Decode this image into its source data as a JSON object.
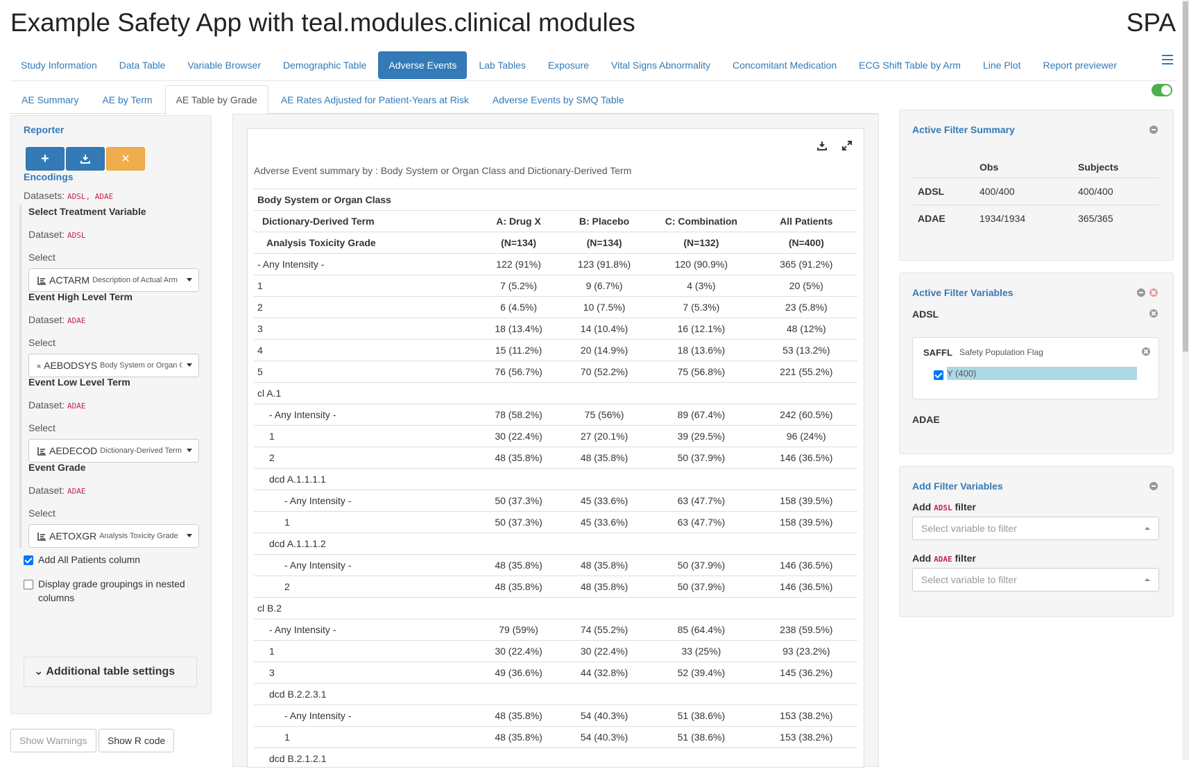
{
  "app": {
    "title": "Example Safety App with teal.modules.clinical modules",
    "brand": "SPA"
  },
  "main_nav": [
    {
      "label": "Study Information",
      "active": false
    },
    {
      "label": "Data Table",
      "active": false
    },
    {
      "label": "Variable Browser",
      "active": false
    },
    {
      "label": "Demographic Table",
      "active": false
    },
    {
      "label": "Adverse Events",
      "active": true
    },
    {
      "label": "Lab Tables",
      "active": false
    },
    {
      "label": "Exposure",
      "active": false
    },
    {
      "label": "Vital Signs Abnormality",
      "active": false
    },
    {
      "label": "Concomitant Medication",
      "active": false
    },
    {
      "label": "ECG Shift Table by Arm",
      "active": false
    },
    {
      "label": "Line Plot",
      "active": false
    },
    {
      "label": "Report previewer",
      "active": false
    }
  ],
  "sub_tabs": [
    {
      "label": "AE Summary",
      "active": false
    },
    {
      "label": "AE by Term",
      "active": false
    },
    {
      "label": "AE Table by Grade",
      "active": true
    },
    {
      "label": "AE Rates Adjusted for Patient-Years at Risk",
      "active": false
    },
    {
      "label": "Adverse Events by SMQ Table",
      "active": false
    }
  ],
  "left_panel": {
    "reporter_label": "Reporter",
    "encodings_label": "Encodings",
    "datasets_label": "Datasets:",
    "datasets_value": "ADSL, ADAE",
    "dataset_prefix": "Dataset:",
    "select_label": "Select",
    "encodings": [
      {
        "title": "Select Treatment Variable",
        "dataset": "ADSL",
        "var": "ACTARM",
        "desc": "Description of Actual Arm"
      },
      {
        "title": "Event High Level Term",
        "dataset": "ADAE",
        "var": "AEBODSYS",
        "desc": "Body System or Organ Class"
      },
      {
        "title": "Event Low Level Term",
        "dataset": "ADAE",
        "var": "AEDECOD",
        "desc": "Dictionary-Derived Term"
      },
      {
        "title": "Event Grade",
        "dataset": "ADAE",
        "var": "AETOXGR",
        "desc": "Analysis Toxicity Grade"
      }
    ],
    "checkbox_all_patients": "Add All Patients column",
    "checkbox_grade_groupings_1": "Display grade groupings in nested",
    "checkbox_grade_groupings_2": "columns",
    "additional_settings": "Additional table settings",
    "show_warnings": "Show Warnings",
    "show_r_code": "Show R code"
  },
  "table": {
    "title": "Adverse Event summary by : Body System or Organ Class and Dictionary-Derived Term",
    "header_row1": "Body System or Organ Class",
    "header_row2": [
      "Dictionary-Derived Term",
      "A: Drug X",
      "B: Placebo",
      "C: Combination",
      "All Patients"
    ],
    "header_row3": [
      "Analysis Toxicity Grade",
      "(N=134)",
      "(N=134)",
      "(N=132)",
      "(N=400)"
    ],
    "rows": [
      {
        "label": "- Any Intensity -",
        "indent": 0,
        "vals": [
          "122 (91%)",
          "123 (91.8%)",
          "120 (90.9%)",
          "365 (91.2%)"
        ]
      },
      {
        "label": "1",
        "indent": 0,
        "vals": [
          "7 (5.2%)",
          "9 (6.7%)",
          "4 (3%)",
          "20 (5%)"
        ]
      },
      {
        "label": "2",
        "indent": 0,
        "vals": [
          "6 (4.5%)",
          "10 (7.5%)",
          "7 (5.3%)",
          "23 (5.8%)"
        ]
      },
      {
        "label": "3",
        "indent": 0,
        "vals": [
          "18 (13.4%)",
          "14 (10.4%)",
          "16 (12.1%)",
          "48 (12%)"
        ]
      },
      {
        "label": "4",
        "indent": 0,
        "vals": [
          "15 (11.2%)",
          "20 (14.9%)",
          "18 (13.6%)",
          "53 (13.2%)"
        ]
      },
      {
        "label": "5",
        "indent": 0,
        "vals": [
          "76 (56.7%)",
          "70 (52.2%)",
          "75 (56.8%)",
          "221 (55.2%)"
        ]
      },
      {
        "label": "cl A.1",
        "indent": 0,
        "vals": [
          "",
          "",
          "",
          ""
        ]
      },
      {
        "label": "- Any Intensity -",
        "indent": 1,
        "vals": [
          "78 (58.2%)",
          "75 (56%)",
          "89 (67.4%)",
          "242 (60.5%)"
        ]
      },
      {
        "label": "1",
        "indent": 1,
        "vals": [
          "30 (22.4%)",
          "27 (20.1%)",
          "39 (29.5%)",
          "96 (24%)"
        ]
      },
      {
        "label": "2",
        "indent": 1,
        "vals": [
          "48 (35.8%)",
          "48 (35.8%)",
          "50 (37.9%)",
          "146 (36.5%)"
        ]
      },
      {
        "label": "dcd A.1.1.1.1",
        "indent": 1,
        "vals": [
          "",
          "",
          "",
          ""
        ]
      },
      {
        "label": "- Any Intensity -",
        "indent": 2,
        "vals": [
          "50 (37.3%)",
          "45 (33.6%)",
          "63 (47.7%)",
          "158 (39.5%)"
        ]
      },
      {
        "label": "1",
        "indent": 2,
        "vals": [
          "50 (37.3%)",
          "45 (33.6%)",
          "63 (47.7%)",
          "158 (39.5%)"
        ]
      },
      {
        "label": "dcd A.1.1.1.2",
        "indent": 1,
        "vals": [
          "",
          "",
          "",
          ""
        ]
      },
      {
        "label": "- Any Intensity -",
        "indent": 2,
        "vals": [
          "48 (35.8%)",
          "48 (35.8%)",
          "50 (37.9%)",
          "146 (36.5%)"
        ]
      },
      {
        "label": "2",
        "indent": 2,
        "vals": [
          "48 (35.8%)",
          "48 (35.8%)",
          "50 (37.9%)",
          "146 (36.5%)"
        ]
      },
      {
        "label": "cl B.2",
        "indent": 0,
        "vals": [
          "",
          "",
          "",
          ""
        ]
      },
      {
        "label": "- Any Intensity -",
        "indent": 1,
        "vals": [
          "79 (59%)",
          "74 (55.2%)",
          "85 (64.4%)",
          "238 (59.5%)"
        ]
      },
      {
        "label": "1",
        "indent": 1,
        "vals": [
          "30 (22.4%)",
          "30 (22.4%)",
          "33 (25%)",
          "93 (23.2%)"
        ]
      },
      {
        "label": "3",
        "indent": 1,
        "vals": [
          "49 (36.6%)",
          "44 (32.8%)",
          "52 (39.4%)",
          "145 (36.2%)"
        ]
      },
      {
        "label": "dcd B.2.2.3.1",
        "indent": 1,
        "vals": [
          "",
          "",
          "",
          ""
        ]
      },
      {
        "label": "- Any Intensity -",
        "indent": 2,
        "vals": [
          "48 (35.8%)",
          "54 (40.3%)",
          "51 (38.6%)",
          "153 (38.2%)"
        ]
      },
      {
        "label": "1",
        "indent": 2,
        "vals": [
          "48 (35.8%)",
          "54 (40.3%)",
          "51 (38.6%)",
          "153 (38.2%)"
        ]
      },
      {
        "label": "dcd B.2.1.2.1",
        "indent": 1,
        "vals": [
          "",
          "",
          "",
          ""
        ]
      }
    ]
  },
  "filter_summary": {
    "title": "Active Filter Summary",
    "col_obs": "Obs",
    "col_subjects": "Subjects",
    "rows": [
      {
        "dataset": "ADSL",
        "obs": "400/400",
        "subjects": "400/400"
      },
      {
        "dataset": "ADAE",
        "obs": "1934/1934",
        "subjects": "365/365"
      }
    ]
  },
  "filter_vars": {
    "title": "Active Filter Variables",
    "adsl": "ADSL",
    "adae": "ADAE",
    "saffl_name": "SAFFL",
    "saffl_label": "Safety Population Flag",
    "saffl_value": "Y (400)"
  },
  "add_filter": {
    "title": "Add Filter Variables",
    "add": "Add",
    "filter": "filter",
    "adsl": "ADSL",
    "adae": "ADAE",
    "placeholder": "Select variable to filter"
  },
  "colors": {
    "primary": "#337ab7",
    "warning": "#f0ad4e",
    "toggle_on": "#4cae4c",
    "filter_bar": "#add8e6"
  }
}
